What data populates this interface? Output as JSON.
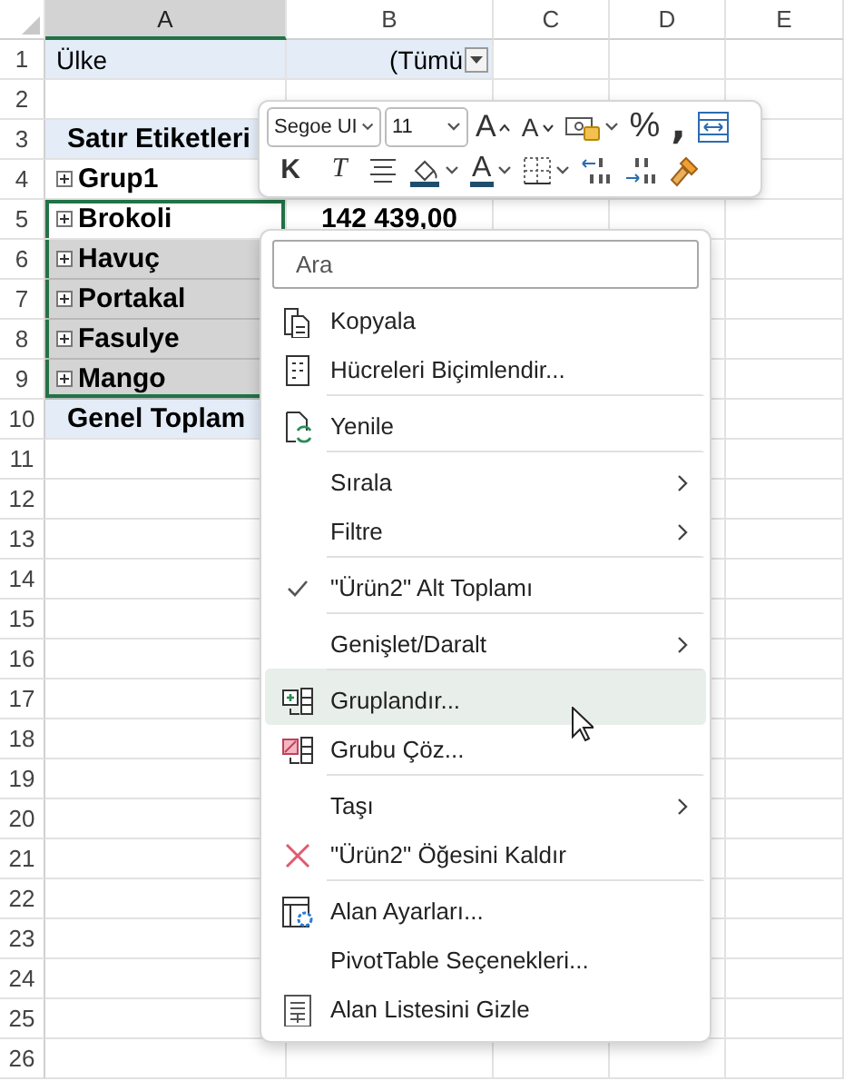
{
  "columns": [
    "A",
    "B",
    "C",
    "D",
    "E"
  ],
  "rows": [
    {
      "header": "1",
      "column_a": {
        "kind": "field",
        "text": "Ülke",
        "selected": false,
        "active": false
      },
      "column_b": {
        "kind": "filter",
        "text": "(Tümü"
      }
    },
    {
      "header": "2"
    },
    {
      "header": "3",
      "column_a": {
        "kind": "heading",
        "text": "Satır Etiketleri",
        "selected": false,
        "active": false
      }
    },
    {
      "header": "4",
      "column_a": {
        "kind": "item",
        "text": "Grup1",
        "selected": false,
        "active": false
      }
    },
    {
      "header": "5",
      "column_a": {
        "kind": "item",
        "text": "Brokoli",
        "selected": true,
        "active": true
      },
      "column_b": {
        "kind": "value",
        "text": "142 439,00"
      }
    },
    {
      "header": "6",
      "column_a": {
        "kind": "item",
        "text": "Havuç",
        "selected": true,
        "active": false
      }
    },
    {
      "header": "7",
      "column_a": {
        "kind": "item",
        "text": "Portakal",
        "selected": true,
        "active": false
      }
    },
    {
      "header": "8",
      "column_a": {
        "kind": "item",
        "text": "Fasulye",
        "selected": true,
        "active": false
      }
    },
    {
      "header": "9",
      "column_a": {
        "kind": "item",
        "text": "Mango",
        "selected": true,
        "active": false
      }
    },
    {
      "header": "10",
      "column_a": {
        "kind": "total",
        "text": "Genel Toplam",
        "selected": false,
        "active": false
      }
    },
    {
      "header": "11"
    },
    {
      "header": "12"
    },
    {
      "header": "13"
    },
    {
      "header": "14"
    },
    {
      "header": "15"
    },
    {
      "header": "16"
    },
    {
      "header": "17"
    },
    {
      "header": "18"
    },
    {
      "header": "19"
    },
    {
      "header": "20"
    },
    {
      "header": "21"
    },
    {
      "header": "22"
    },
    {
      "header": "23"
    },
    {
      "header": "24"
    },
    {
      "header": "25"
    },
    {
      "header": "26"
    }
  ],
  "mini_toolbar": {
    "font": "Segoe UI",
    "size": "11",
    "row_1": [
      {
        "kind": "grow_font",
        "label": "A"
      },
      {
        "kind": "shrink_font",
        "label": "A"
      },
      {
        "kind": "number_format"
      },
      {
        "kind": "percent",
        "label": "%"
      },
      {
        "kind": "comma",
        "label": ","
      },
      {
        "kind": "wrap"
      }
    ],
    "row_2": [
      {
        "kind": "bold",
        "label": "K"
      },
      {
        "kind": "italic",
        "label": "T"
      },
      {
        "kind": "center"
      },
      {
        "kind": "fill_color"
      },
      {
        "kind": "font_color",
        "label": "A"
      },
      {
        "kind": "borders"
      },
      {
        "kind": "decrease_decimal"
      },
      {
        "kind": "increase_decimal"
      },
      {
        "kind": "format_painter"
      }
    ]
  },
  "menu": {
    "search": {
      "placeholder": "Ara"
    },
    "items": [
      {
        "kind": "copy",
        "label": "Kopyala",
        "separator_before": false,
        "submenu": false,
        "checked": false,
        "selected": false
      },
      {
        "kind": "format_cells",
        "label": "Hücreleri Biçimlendir...",
        "separator_before": false,
        "submenu": false,
        "checked": false,
        "selected": false
      },
      {
        "kind": "refresh",
        "label": "Yenile",
        "separator_before": true,
        "submenu": false,
        "checked": false,
        "selected": false
      },
      {
        "kind": "plain",
        "label": "Sırala",
        "separator_before": true,
        "submenu": true,
        "checked": false,
        "selected": false
      },
      {
        "kind": "plain",
        "label": "Filtre",
        "separator_before": false,
        "submenu": true,
        "checked": false,
        "selected": false
      },
      {
        "kind": "plain",
        "label": "\"Ürün2\" Alt Toplamı",
        "separator_before": true,
        "submenu": false,
        "checked": true,
        "selected": false
      },
      {
        "kind": "plain",
        "label": "Genişlet/Daralt",
        "separator_before": true,
        "submenu": true,
        "checked": false,
        "selected": false
      },
      {
        "kind": "group",
        "label": "Gruplandır...",
        "separator_before": true,
        "submenu": false,
        "checked": false,
        "selected": true
      },
      {
        "kind": "ungroup",
        "label": "Grubu Çöz...",
        "separator_before": false,
        "submenu": false,
        "checked": false,
        "selected": false
      },
      {
        "kind": "plain",
        "label": "Taşı",
        "separator_before": true,
        "submenu": true,
        "checked": false,
        "selected": false
      },
      {
        "kind": "remove",
        "label": "\"Ürün2\" Öğesini Kaldır",
        "separator_before": false,
        "submenu": false,
        "checked": false,
        "selected": false
      },
      {
        "kind": "field_settings",
        "label": "Alan Ayarları...",
        "separator_before": true,
        "submenu": false,
        "checked": false,
        "selected": false
      },
      {
        "kind": "plain",
        "label": "PivotTable Seçenekleri...",
        "separator_before": false,
        "submenu": false,
        "checked": false,
        "selected": false
      },
      {
        "kind": "field_list",
        "label": "Alan Listesini Gizle",
        "separator_before": false,
        "submenu": false,
        "checked": false,
        "selected": false
      }
    ]
  }
}
